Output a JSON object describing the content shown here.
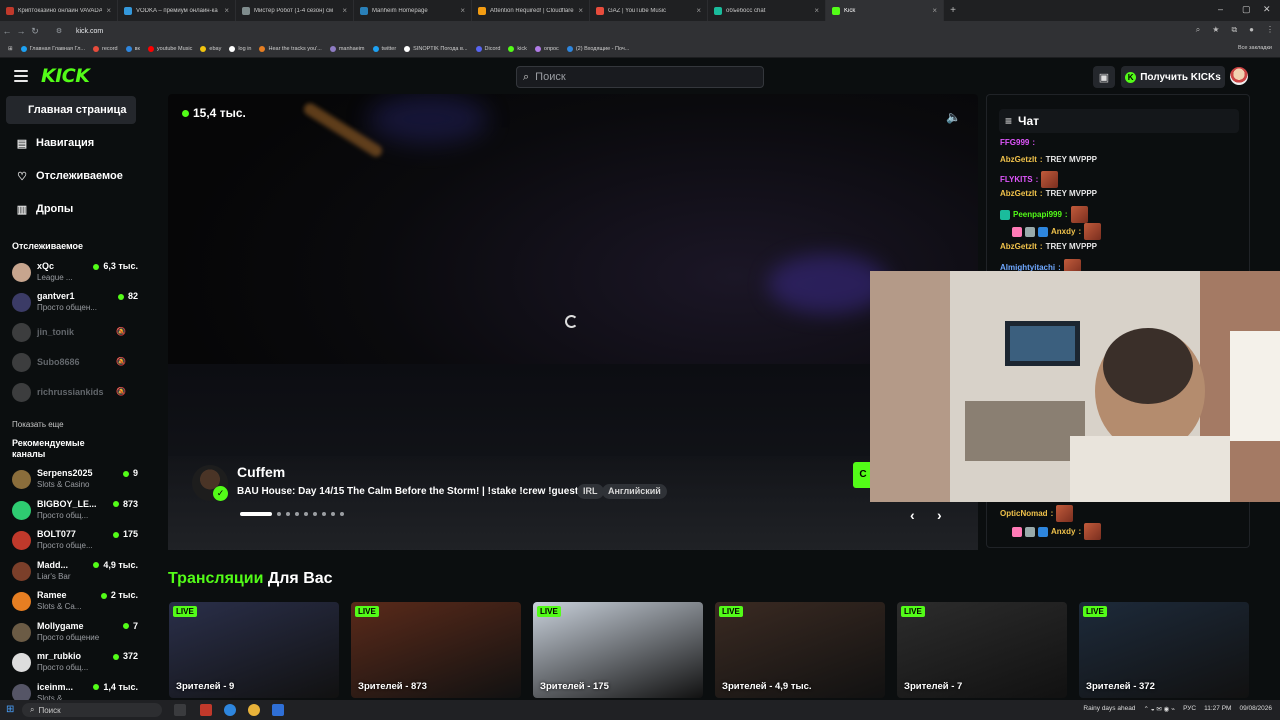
{
  "browser": {
    "tabs": [
      {
        "title": "Криптоказино онлайн VAVADA",
        "color": "#c0392b"
      },
      {
        "title": "VODKA – премиум онлайн-ка",
        "color": "#3498db"
      },
      {
        "title": "Мистер Робот (1-4 сезон) см",
        "color": "#7f8c8d"
      },
      {
        "title": "Manheim Homepage",
        "color": "#2980b9"
      },
      {
        "title": "Attention Required! | Cloudflare",
        "color": "#f39c12"
      },
      {
        "title": "GAZ | YouTube Music",
        "color": "#e74c3c"
      },
      {
        "title": "объебосс chat",
        "color": "#1abc9c"
      },
      {
        "title": "Kick",
        "color": "#53fc18"
      }
    ],
    "url": "kick.com",
    "bookmarks": [
      "Главная Главная Гл...",
      "record",
      "вк",
      "youtube Music",
      "ebay",
      "log in",
      "Hear the tracks you'...",
      "manhaeim",
      "twitter",
      "SINOPTIK Погода в...",
      "Dicord",
      "kick",
      "опрос",
      "(2) Входящие - Поч..."
    ],
    "bookmarks_right": "Все закладки"
  },
  "header": {
    "logo": "KICK",
    "search_placeholder": "Поиск",
    "get_kicks": "Получить KICKs"
  },
  "sidebar": {
    "nav": [
      {
        "label": "Главная страница",
        "icon": "home-icon"
      },
      {
        "label": "Навигация",
        "icon": "browse-icon"
      },
      {
        "label": "Отслеживаемое",
        "icon": "heart-icon"
      },
      {
        "label": "Дропы",
        "icon": "drops-icon"
      }
    ],
    "following_title": "Отслеживаемое",
    "following": [
      {
        "name": "xQc",
        "sub": "League ...",
        "viewers": "6,3 тыс."
      },
      {
        "name": "gantver1",
        "sub": "Просто общен...",
        "viewers": "82"
      },
      {
        "name": "jin_tonik",
        "sub": "",
        "viewers": ""
      },
      {
        "name": "Subo8686",
        "sub": "",
        "viewers": ""
      },
      {
        "name": "richrussiankids",
        "sub": "",
        "viewers": ""
      }
    ],
    "show_more": "Показать еще",
    "recommended_title": "Рекомендуемые каналы",
    "recommended": [
      {
        "name": "Serpens2025",
        "sub": "Slots & Casino",
        "viewers": "9"
      },
      {
        "name": "BIGBOY_LE...",
        "sub": "Просто общ...",
        "viewers": "873"
      },
      {
        "name": "BOLT077",
        "sub": "Просто общe...",
        "viewers": "175"
      },
      {
        "name": "Madd...",
        "sub": "Liar's Bar",
        "viewers": "4,9 тыс."
      },
      {
        "name": "Ramee",
        "sub": "Slots & Ca...",
        "viewers": "2 тыс."
      },
      {
        "name": "Mollygame",
        "sub": "Просто общение",
        "viewers": "7"
      },
      {
        "name": "mr_rubkio",
        "sub": "Просто общ...",
        "viewers": "372"
      },
      {
        "name": "iceinm...",
        "sub": "Slots & ...",
        "viewers": "1,4 тыс."
      }
    ]
  },
  "player": {
    "viewers": "15,4 тыс.",
    "streamer": "Cuffem",
    "title": "BAU House: Day 14/15 The Calm Before the Storm! | !stake !crew !guest",
    "tags": [
      "IRL",
      "Английский"
    ],
    "carousel_index": 1,
    "carousel_total": 9
  },
  "chat": {
    "title": "Чат",
    "messages": [
      {
        "user": "FFG999",
        "color": "#e056fd",
        "text": ""
      },
      {
        "user": "AbzGetzIt",
        "color": "#f0c24b",
        "text": "TREY MVPPP"
      },
      {
        "user": "FLYKITS",
        "color": "#e056fd",
        "text": ""
      },
      {
        "user": "AbzGetzIt",
        "color": "#f0c24b",
        "text": "TREY MVPPP"
      },
      {
        "user": "Peenpapi999",
        "color": "#53fc18",
        "text": ""
      },
      {
        "user": "Anxdy",
        "color": "#f0c24b",
        "text": ""
      },
      {
        "user": "AbzGetzIt",
        "color": "#f0c24b",
        "text": "TREY MVPPP"
      },
      {
        "user": "Almightyitachi",
        "color": "#6fa8ff",
        "text": ""
      },
      {
        "user": "OpticNomad",
        "color": "#f0c24b",
        "text": ""
      },
      {
        "user": "Anxdy",
        "color": "#f0c24b",
        "text": ""
      }
    ]
  },
  "section": {
    "title_accent": "Трансляции",
    "title_rest": "Для Вас"
  },
  "cards": [
    {
      "live": "LIVE",
      "viewers": "Зрителей - 9",
      "color": "#2a2f4a"
    },
    {
      "live": "LIVE",
      "viewers": "Зрителей - 873",
      "color": "#5a2a1a"
    },
    {
      "live": "LIVE",
      "viewers": "Зрителей - 175",
      "color": "#c9d1db"
    },
    {
      "live": "LIVE",
      "viewers": "Зрителей - 4,9 тыс.",
      "color": "#3a2a22"
    },
    {
      "live": "LIVE",
      "viewers": "Зрителей - 7",
      "color": "#2c2c2c"
    },
    {
      "live": "LIVE",
      "viewers": "Зрителей - 372",
      "color": "#1d2a3a"
    }
  ],
  "taskbar": {
    "search": "Поиск",
    "weather": "Rainy days ahead",
    "lang": "РУС",
    "time": "11:27 PM",
    "date": "09/08/2026"
  }
}
